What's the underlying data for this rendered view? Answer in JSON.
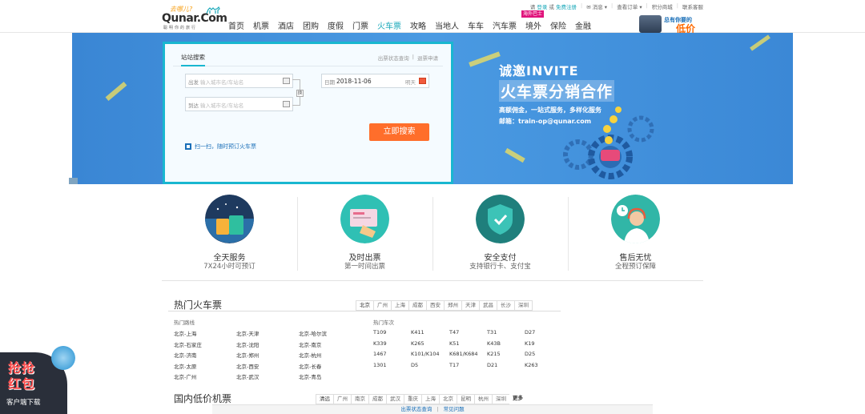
{
  "header": {
    "logo_slogan": "去哪儿?",
    "logo_name": "Qunar.Com",
    "logo_tagline": "聪明你的旅行",
    "nav": [
      {
        "label": "首页",
        "active": false
      },
      {
        "label": "机票",
        "active": false
      },
      {
        "label": "酒店",
        "active": false
      },
      {
        "label": "团购",
        "active": false
      },
      {
        "label": "度假",
        "active": false
      },
      {
        "label": "门票",
        "active": false
      },
      {
        "label": "火车票",
        "active": true
      },
      {
        "label": "攻略",
        "active": false
      },
      {
        "label": "当地人",
        "active": false
      },
      {
        "label": "车车",
        "active": false
      },
      {
        "label": "汽车票",
        "active": false
      },
      {
        "label": "境外",
        "active": false
      },
      {
        "label": "保险",
        "active": false
      },
      {
        "label": "金融",
        "active": false
      }
    ],
    "overseas_badge": "海外巴士",
    "topbar": {
      "please": "请",
      "login": "登录",
      "or": "或",
      "register": "免费注册",
      "messages": "✉ 消息 ▾",
      "orders": "查看订单 ▾",
      "points": "积分商城",
      "service": "联系客服"
    },
    "promo_line1": "总有你要的",
    "promo_line2": "低价"
  },
  "search": {
    "tab": "站站搜索",
    "link_status": "出票状态查询",
    "link_refund": "退票申请",
    "from_label": "出发",
    "from_placeholder": "输入城市名/车站名",
    "to_label": "到达",
    "to_placeholder": "输入城市名/车站名",
    "date_label": "日期",
    "date_value": "2018-11-06",
    "date_suffix": "明天",
    "swap_label": "换",
    "button": "立即搜索",
    "scan_text": "扫一扫，随时预订火车票"
  },
  "banner": {
    "line1": "诚邀INVITE",
    "line2": "火车票分销合作",
    "line3": "高额佣金，一站式服务，多样化服务",
    "line4": "邮箱：train-op@qunar.com"
  },
  "services": [
    {
      "title": "全天服务",
      "sub": "7X24小时可预订",
      "icon": "luggage-icon"
    },
    {
      "title": "及时出票",
      "sub": "第一时间出票",
      "icon": "ticket-icon"
    },
    {
      "title": "安全支付",
      "sub": "支持银行卡、支付宝",
      "icon": "shield-icon"
    },
    {
      "title": "售后无忧",
      "sub": "全程预订保障",
      "icon": "headset-agent-icon"
    }
  ],
  "hot": {
    "title": "热门火车票",
    "cities": [
      "北京",
      "广州",
      "上海",
      "成都",
      "西安",
      "郑州",
      "天津",
      "武昌",
      "长沙",
      "深圳"
    ],
    "routes_head": "热门路线",
    "routes": [
      [
        "北京-上海",
        "北京-天津",
        "北京-哈尔滨"
      ],
      [
        "北京-石家庄",
        "北京-沈阳",
        "北京-南京"
      ],
      [
        "北京-济南",
        "北京-郑州",
        "北京-杭州"
      ],
      [
        "北京-太原",
        "北京-西安",
        "北京-长春"
      ],
      [
        "北京-广州",
        "北京-武汉",
        "北京-青岛"
      ]
    ],
    "trains_head": "热门车次",
    "trains": [
      [
        "T109",
        "K411",
        "T47",
        "T31",
        "D27"
      ],
      [
        "K339",
        "K265",
        "K51",
        "K43B",
        "K19"
      ],
      [
        "1467",
        "K101/K104",
        "K681/K684",
        "K215",
        "D25"
      ],
      [
        "1301",
        "D5",
        "T17",
        "D21",
        "K263"
      ]
    ]
  },
  "low": {
    "title": "国内低价机票",
    "cities": [
      "清远",
      "广州",
      "南京",
      "成都",
      "武汉",
      "重庆",
      "上海",
      "北京",
      "昆明",
      "杭州",
      "深圳"
    ],
    "more": "更多"
  },
  "footer": {
    "status": "出票状态查询",
    "sep": "|",
    "faq": "常见问题"
  },
  "redpack": {
    "word1": "抢抢",
    "word2": "红包",
    "download": "客户端下载"
  }
}
